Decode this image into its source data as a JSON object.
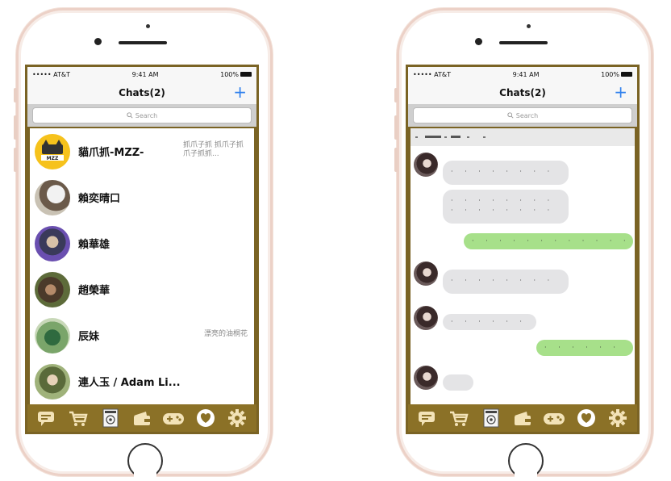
{
  "status": {
    "carrier": "••••• AT&T",
    "time": "9:41 AM",
    "battery": "100%"
  },
  "nav": {
    "title": "Chats(2)",
    "plus": "+"
  },
  "search": {
    "placeholder": "Search",
    "icon": "search-icon"
  },
  "chats": [
    {
      "name": "貓爪抓-MZZ-",
      "preview": "抓爪子抓 抓爪子抓爪子抓抓..."
    },
    {
      "name": "賴奕晴口",
      "preview": ""
    },
    {
      "name": "賴華雄",
      "preview": ""
    },
    {
      "name": "趙榮華",
      "preview": ""
    },
    {
      "name": "辰妹",
      "preview": "漂亮的油桐花"
    },
    {
      "name": "連人玉 / Adam Li...",
      "preview": ""
    }
  ],
  "tabs": [
    "chat-bubble-icon",
    "cart-icon",
    "magazine-icon",
    "wallet-icon",
    "gamepad-icon",
    "heart-icon",
    "gear-icon"
  ],
  "colors": {
    "frame": "#ecd1c7",
    "accent": "#8b7127",
    "outgoing": "#a7e08a",
    "incoming": "#e4e4e6",
    "link": "#2f80ed"
  }
}
